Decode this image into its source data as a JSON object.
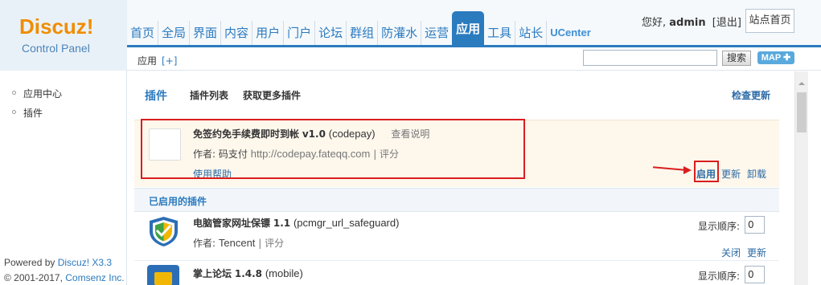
{
  "logo": {
    "main": "Discuz!",
    "sub": "Control Panel"
  },
  "nav": {
    "items": [
      "首页",
      "全局",
      "界面",
      "内容",
      "用户",
      "门户",
      "论坛",
      "群组",
      "防灌水",
      "运营",
      "应用",
      "工具",
      "站长",
      "UCenter"
    ],
    "active": "应用"
  },
  "user": {
    "greeting": "您好,",
    "name": "admin",
    "logout": "[退出]",
    "site_home": "站点首页"
  },
  "subbar": {
    "crumb": "应用",
    "add": "[+]",
    "search_placeholder": "",
    "search_button": "搜索",
    "map_button": "MAP ✚"
  },
  "sidebar": {
    "items": [
      "应用中心",
      "插件"
    ],
    "powered_by": "Powered by",
    "powered_link": "Discuz! X3.3",
    "copyright": "© 2001-2017,",
    "copyright_link": "Comsenz Inc."
  },
  "main": {
    "tabs": {
      "current": "插件",
      "list": "插件列表",
      "more": "获取更多插件"
    },
    "check_update": "检查更新",
    "new_plugin": {
      "name": "免签约免手续费即时到帐",
      "version": "v1.0",
      "identifier": "(codepay)",
      "readme": "查看说明",
      "author_label": "作者:",
      "author": "码支付",
      "author_url": "http://codepay.fateqq.com",
      "rating": "| 评分",
      "help": "使用帮助",
      "actions": [
        "启用",
        "更新",
        "卸载"
      ]
    },
    "enabled_section": "已启用的插件",
    "enabled_plugins": [
      {
        "name": "电脑管家网址保镖",
        "version": "1.1",
        "identifier": "(pcmgr_url_safeguard)",
        "author_label": "作者:",
        "author": "Tencent",
        "rating": "| 评分",
        "order_label": "显示顺序:",
        "order": "0",
        "actions": [
          "关闭",
          "更新"
        ]
      },
      {
        "name": "掌上论坛",
        "version": "1.4.8",
        "identifier": "(mobile)",
        "order_label": "显示顺序:",
        "order": "0"
      }
    ]
  },
  "colors": {
    "accent": "#2b7bbf",
    "logo_orange": "#f08d00",
    "highlight_red": "#d91e1e",
    "new_row_bg": "#fdf7ec"
  }
}
